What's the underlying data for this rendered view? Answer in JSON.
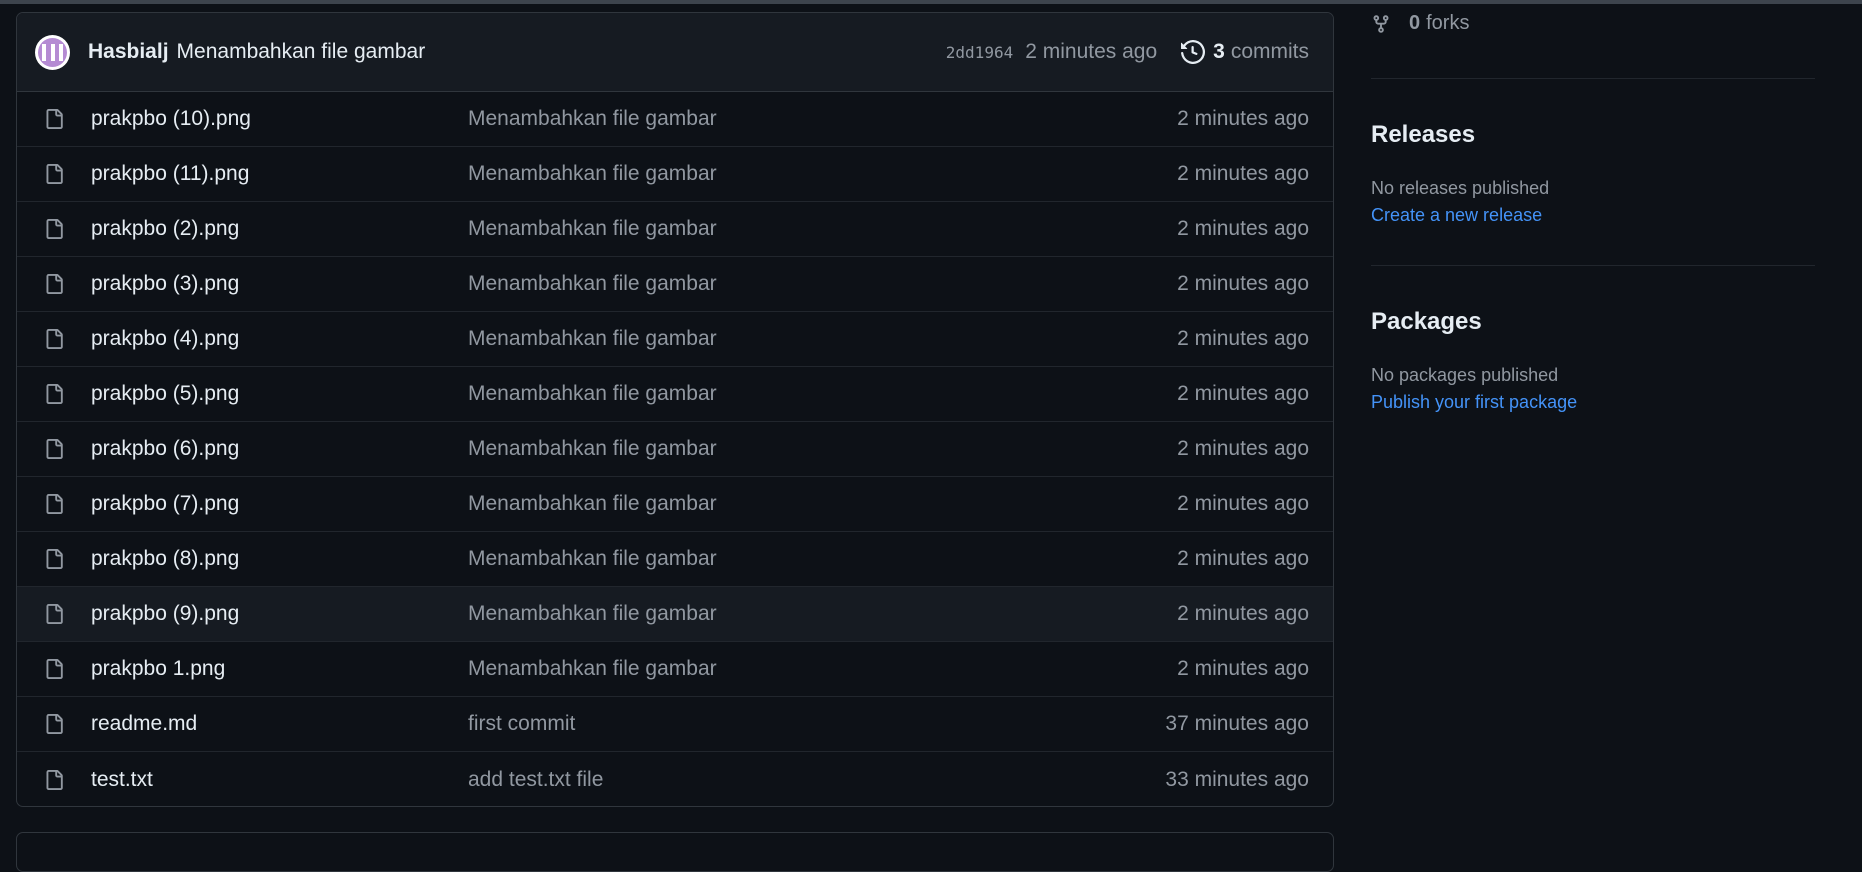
{
  "commit": {
    "author": "Hasbialj",
    "message": "Menambahkan file gambar",
    "sha": "2dd1964",
    "time": "2 minutes ago",
    "commit_count": "3",
    "commits_label": "commits"
  },
  "files": [
    {
      "name": "prakpbo (10).png",
      "message": "Menambahkan file gambar",
      "time": "2 minutes ago"
    },
    {
      "name": "prakpbo (11).png",
      "message": "Menambahkan file gambar",
      "time": "2 minutes ago"
    },
    {
      "name": "prakpbo (2).png",
      "message": "Menambahkan file gambar",
      "time": "2 minutes ago"
    },
    {
      "name": "prakpbo (3).png",
      "message": "Menambahkan file gambar",
      "time": "2 minutes ago"
    },
    {
      "name": "prakpbo (4).png",
      "message": "Menambahkan file gambar",
      "time": "2 minutes ago"
    },
    {
      "name": "prakpbo (5).png",
      "message": "Menambahkan file gambar",
      "time": "2 minutes ago"
    },
    {
      "name": "prakpbo (6).png",
      "message": "Menambahkan file gambar",
      "time": "2 minutes ago"
    },
    {
      "name": "prakpbo (7).png",
      "message": "Menambahkan file gambar",
      "time": "2 minutes ago"
    },
    {
      "name": "prakpbo (8).png",
      "message": "Menambahkan file gambar",
      "time": "2 minutes ago"
    },
    {
      "name": "prakpbo (9).png",
      "message": "Menambahkan file gambar",
      "time": "2 minutes ago"
    },
    {
      "name": "prakpbo 1.png",
      "message": "Menambahkan file gambar",
      "time": "2 minutes ago"
    },
    {
      "name": "readme.md",
      "message": "first commit",
      "time": "37 minutes ago"
    },
    {
      "name": "test.txt",
      "message": "add test.txt file",
      "time": "33 minutes ago"
    }
  ],
  "sidebar": {
    "forks_count": "0",
    "forks_label": "forks",
    "releases": {
      "title": "Releases",
      "text": "No releases published",
      "link": "Create a new release"
    },
    "packages": {
      "title": "Packages",
      "text": "No packages published",
      "link": "Publish your first package"
    }
  },
  "colors": {
    "background": "#0d1117",
    "link": "#4493f8",
    "muted": "#9198a1",
    "hover_row": "#161b22"
  }
}
